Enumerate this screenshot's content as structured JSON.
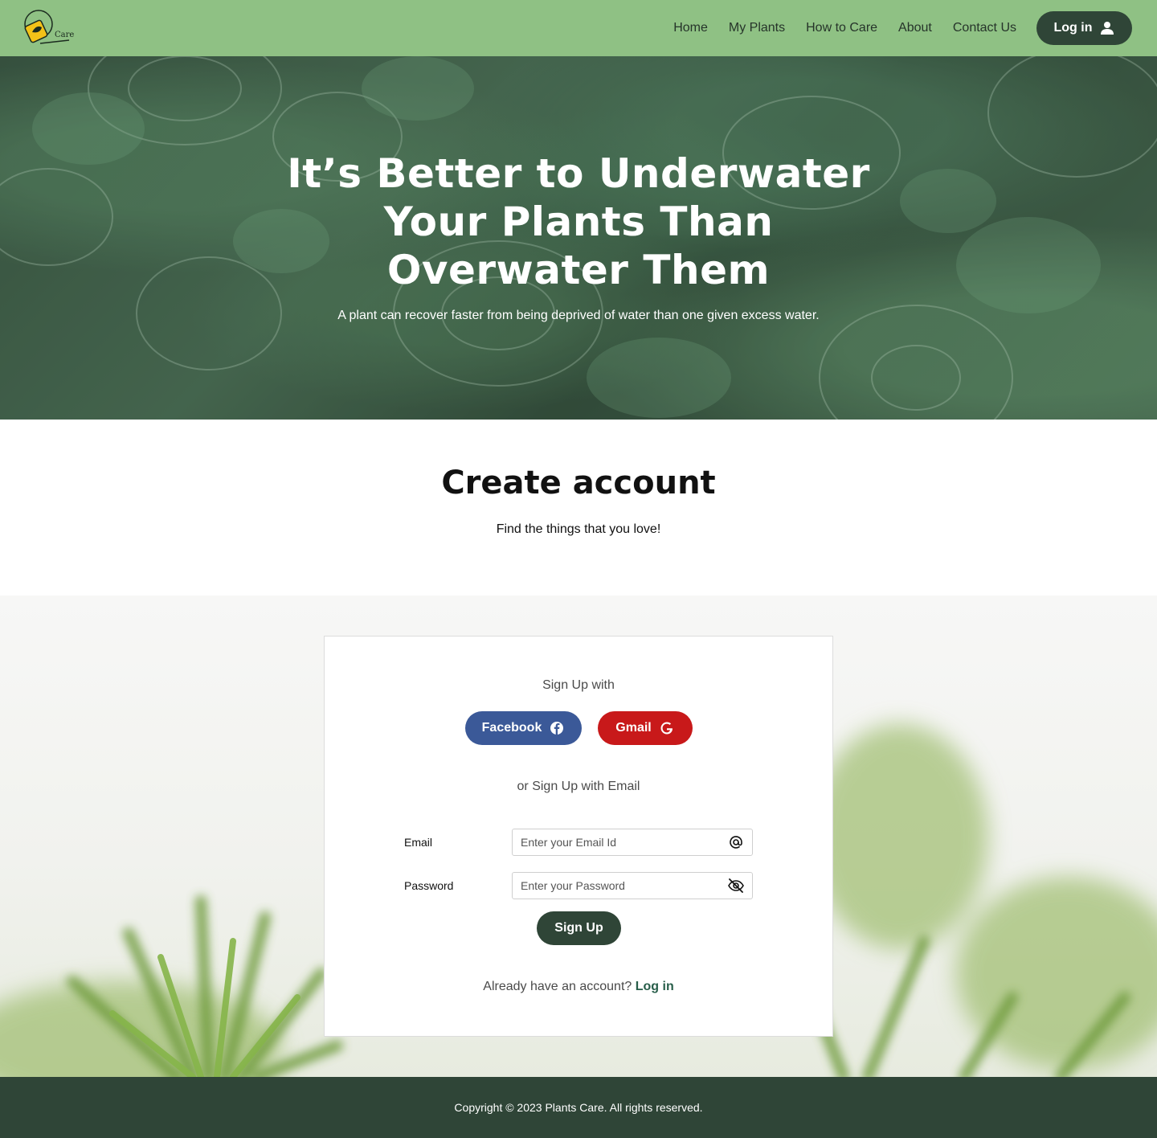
{
  "brand": {
    "logo_text": "Care"
  },
  "nav": {
    "items": [
      {
        "label": "Home"
      },
      {
        "label": "My Plants"
      },
      {
        "label": "How to Care"
      },
      {
        "label": "About"
      },
      {
        "label": "Contact Us"
      }
    ],
    "login_label": "Log in"
  },
  "hero": {
    "title": "It’s Better to Underwater Your Plants Than Overwater Them",
    "subtitle": "A plant can recover faster from being deprived of water than one given excess water."
  },
  "create": {
    "title": "Create account",
    "subtitle": "Find the things that you love!"
  },
  "form": {
    "signup_with": "Sign Up with",
    "facebook_label": "Facebook",
    "gmail_label": "Gmail",
    "or_email": "or Sign Up with Email",
    "email_label": "Email",
    "email_placeholder": "Enter your Email Id",
    "password_label": "Password",
    "password_placeholder": "Enter your Password",
    "submit_label": "Sign Up",
    "have_account": "Already have an account?",
    "login_link": "Log in"
  },
  "footer": {
    "copyright": "Copyright © 2023 Plants Care. All rights reserved."
  },
  "colors": {
    "header": "#8fc184",
    "dark_green": "#2f4537",
    "facebook": "#3b5998",
    "gmail": "#c8191a",
    "link": "#285e4a"
  },
  "icons": {
    "user": "user-icon",
    "facebook": "facebook-icon",
    "google": "google-icon",
    "at": "at-icon",
    "eye_off": "eye-off-icon"
  }
}
